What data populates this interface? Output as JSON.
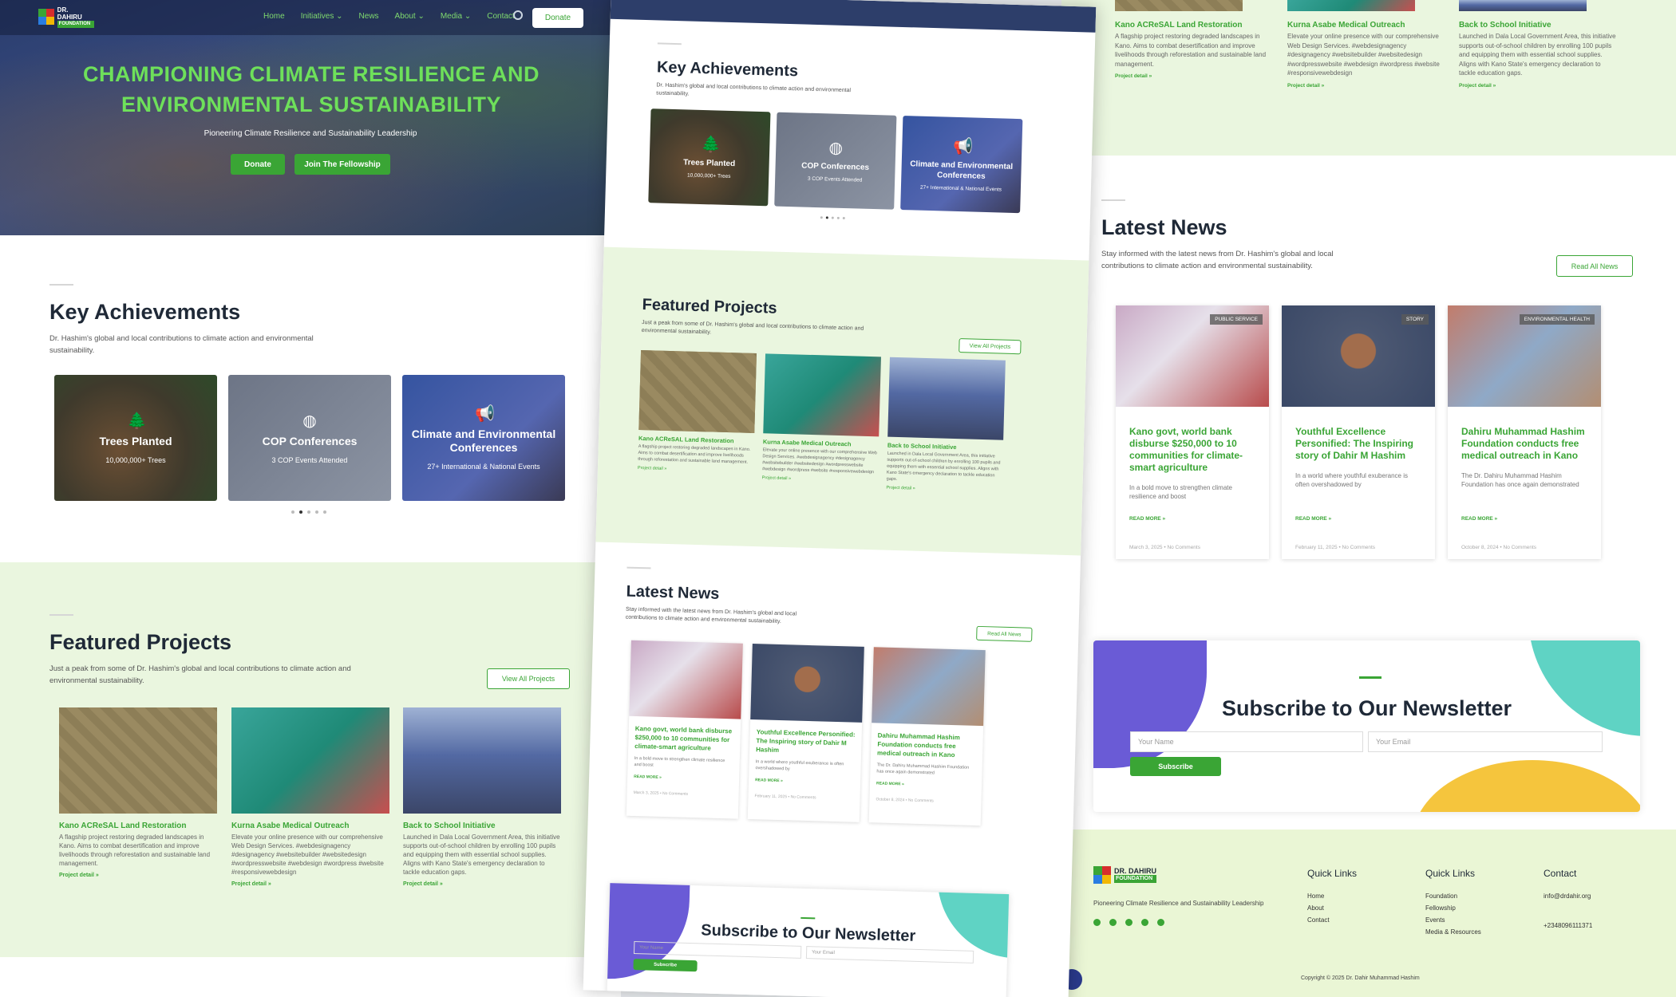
{
  "nav": {
    "logo_line1": "DR. DAHIRU",
    "logo_line2": "FOUNDATION",
    "items": [
      "Home",
      "Initiatives ⌄",
      "News",
      "About ⌄",
      "Media ⌄",
      "Contact"
    ],
    "donate": "Donate"
  },
  "hero": {
    "title": "CHAMPIONING CLIMATE RESILIENCE AND ENVIRONMENTAL SUSTAINABILITY",
    "subtitle": "Pioneering Climate Resilience and Sustainability Leadership",
    "donate_btn": "Donate",
    "fellowship_btn": "Join The Fellowship"
  },
  "achievements": {
    "title": "Key Achievements",
    "desc": "Dr. Hashim's global and local contributions to climate action and environmental sustainability.",
    "cards": [
      {
        "title": "Trees Planted",
        "value": "10,000,000+ Trees",
        "icon": "tree-icon"
      },
      {
        "title": "COP Conferences",
        "value": "3 COP Events Attended",
        "icon": "globe-icon"
      },
      {
        "title": "Climate and Environmental Conferences",
        "value": "27+ International & National Events",
        "icon": "megaphone-icon"
      }
    ]
  },
  "projects": {
    "title": "Featured Projects",
    "desc": "Just a peak from some of Dr. Hashim's global and local contributions to climate action and environmental sustainability.",
    "view_all": "View All Projects",
    "items": [
      {
        "title": "Kano ACReSAL Land Restoration",
        "desc": "A flagship project restoring degraded landscapes in Kano. Aims to combat desertification and improve livelihoods through reforestation and sustainable land management.",
        "link": "Project detail »"
      },
      {
        "title": "Kurna Asabe Medical Outreach",
        "desc": "Elevate your online presence with our comprehensive Web Design Services. #webdesignagency #designagency #websitebuilder #websitedesign #wordpresswebsite #webdesign #wordpress #website #responsivewebdesign",
        "link": "Project detail »"
      },
      {
        "title": "Back to School Initiative",
        "desc": "Launched in Dala Local Government Area, this initiative supports out-of-school children by enrolling 100 pupils and equipping them with essential school supplies. Aligns with Kano State's emergency declaration to tackle education gaps.",
        "link": "Project detail »"
      }
    ]
  },
  "news": {
    "title": "Latest News",
    "desc": "Stay informed with the latest news from Dr. Hashim's global and local contributions to climate action and environmental sustainability.",
    "read_all": "Read All News",
    "items": [
      {
        "badge": "Public Service",
        "title": "Kano govt, world bank disburse $250,000 to 10 communities for climate-smart agriculture",
        "excerpt": "In a bold move to strengthen climate resilience and boost",
        "read_more": "READ MORE »",
        "meta": "March 3, 2025 • No Comments"
      },
      {
        "badge": "Story",
        "title": "Youthful Excellence Personified: The Inspiring story of Dahir M Hashim",
        "excerpt": "In a world where youthful exuberance is often overshadowed by",
        "read_more": "READ MORE »",
        "meta": "February 11, 2025 • No Comments"
      },
      {
        "badge": "Environmental Health",
        "title": "Dahiru Muhammad Hashim Foundation conducts free medical outreach in Kano",
        "excerpt": "The Dr. Dahiru Muhammad Hashim Foundation has once again demonstrated",
        "read_more": "READ MORE »",
        "meta": "October 8, 2024 • No Comments"
      }
    ]
  },
  "newsletter": {
    "title": "Subscribe to Our Newsletter",
    "name_placeholder": "Your Name",
    "email_placeholder": "Your Email",
    "subscribe": "Subscribe"
  },
  "footer": {
    "tagline": "Pioneering Climate Resilience and Sustainability Leadership",
    "col1_title": "Quick Links",
    "col1": [
      "Home",
      "About",
      "Contact"
    ],
    "col2_title": "Quick Links",
    "col2": [
      "Foundation",
      "Fellowship",
      "Events",
      "Media & Resources"
    ],
    "contact_title": "Contact",
    "email": "info@drdahir.org",
    "phone": "+2348096111371",
    "copyright": "Copyright © 2025 Dr. Dahir Muhammad Hashim"
  }
}
